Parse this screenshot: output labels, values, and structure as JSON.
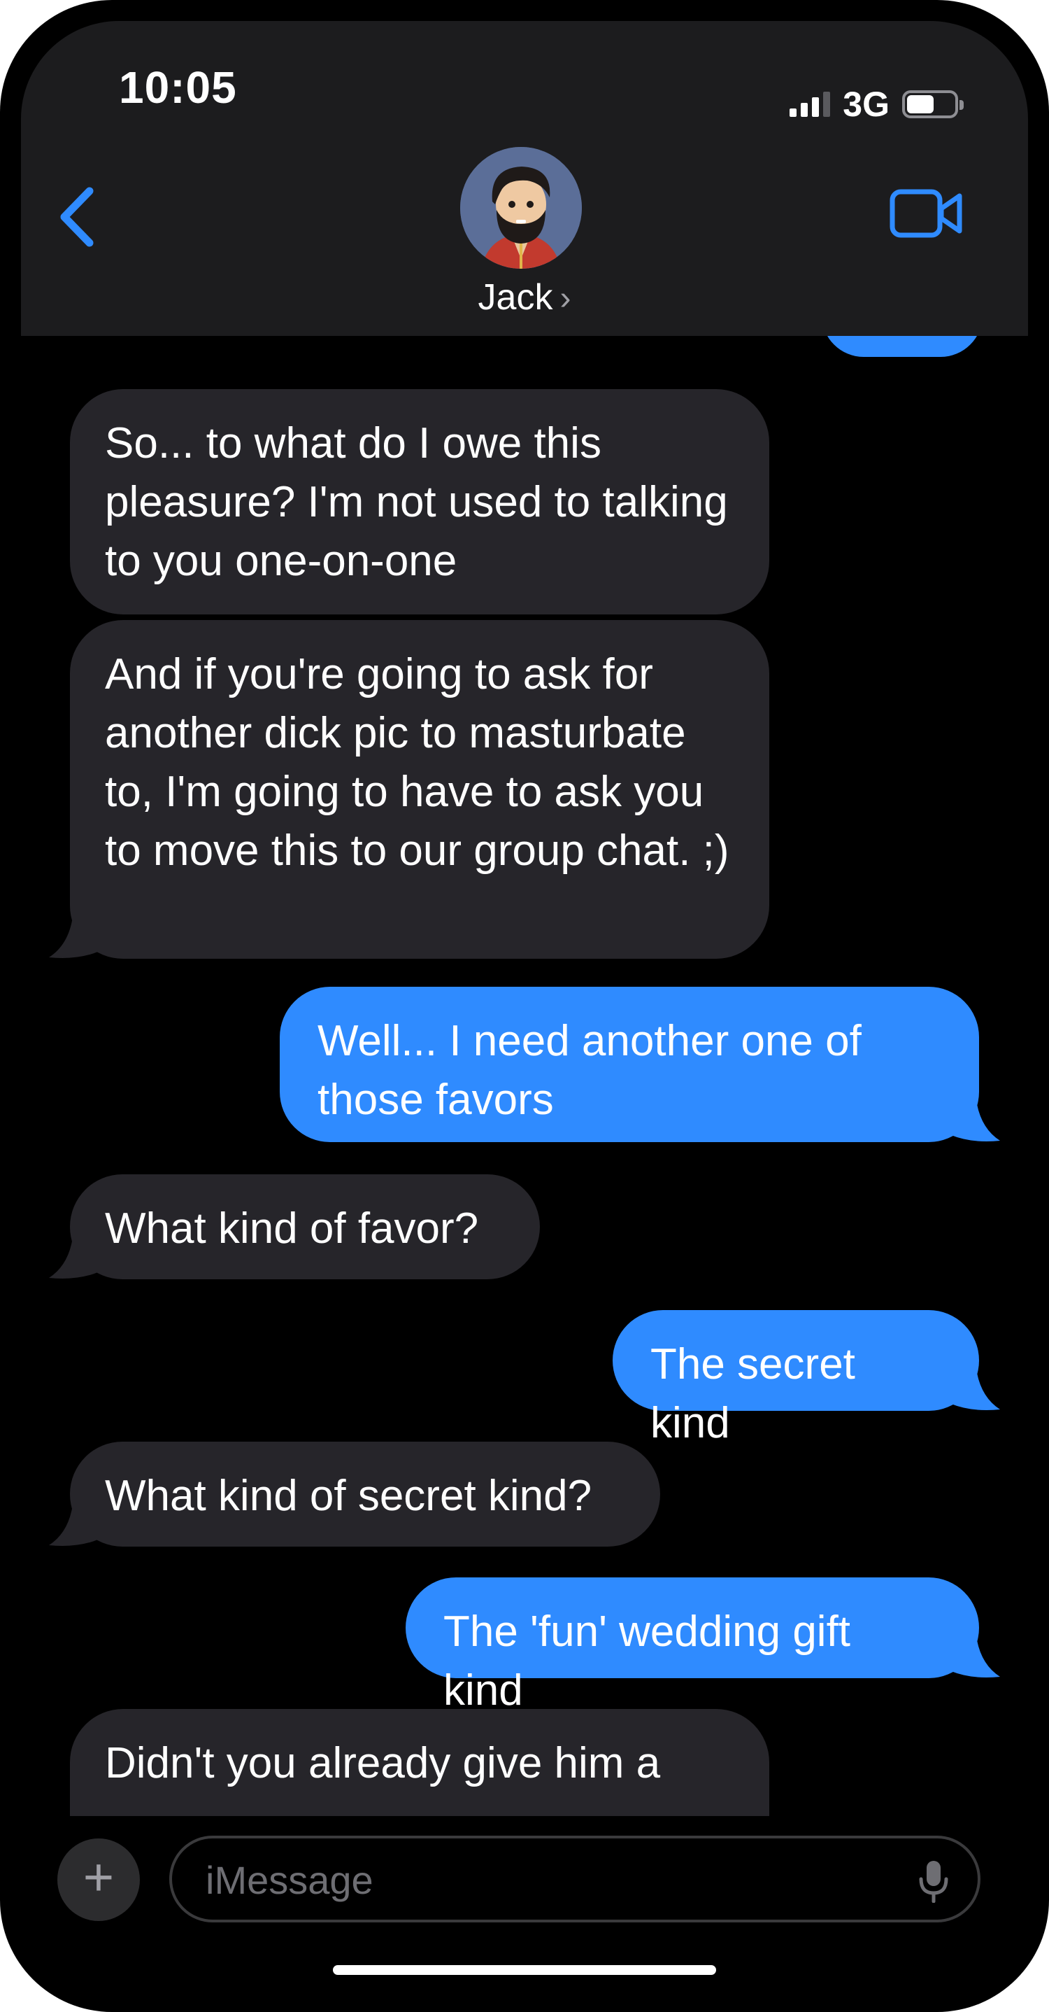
{
  "status_bar": {
    "time": "10:05",
    "network": "3G",
    "icons": [
      "cellular-signal-icon",
      "battery-icon"
    ]
  },
  "header": {
    "contact_name": "Jack",
    "contact_chevron": "›",
    "icons": [
      "back-chevron-icon",
      "facetime-video-icon",
      "contact-avatar"
    ]
  },
  "messages": [
    {
      "from": "them",
      "text": "So... to what do I owe this pleasure?  I'm not used to talking to you one-on-one"
    },
    {
      "from": "them",
      "text": "And if you're going to ask for another dick pic to masturbate to, I'm going to have to ask you to move this to our group chat. ;)"
    },
    {
      "from": "me",
      "text": "Well... I need another one of those favors"
    },
    {
      "from": "them",
      "text": "What kind of favor?"
    },
    {
      "from": "me",
      "text": "The secret kind"
    },
    {
      "from": "them",
      "text": "What kind of secret kind?"
    },
    {
      "from": "me",
      "text": "The 'fun' wedding gift kind"
    },
    {
      "from": "them",
      "text": "Didn't you already give him a"
    }
  ],
  "compose": {
    "placeholder": "iMessage",
    "plus_label": "+",
    "icons": [
      "plus-icon",
      "microphone-icon"
    ]
  },
  "colors": {
    "outgoing": "#2f8bff",
    "incoming": "#26252a",
    "header": "#1c1c1e",
    "accent": "#2f8bff"
  }
}
